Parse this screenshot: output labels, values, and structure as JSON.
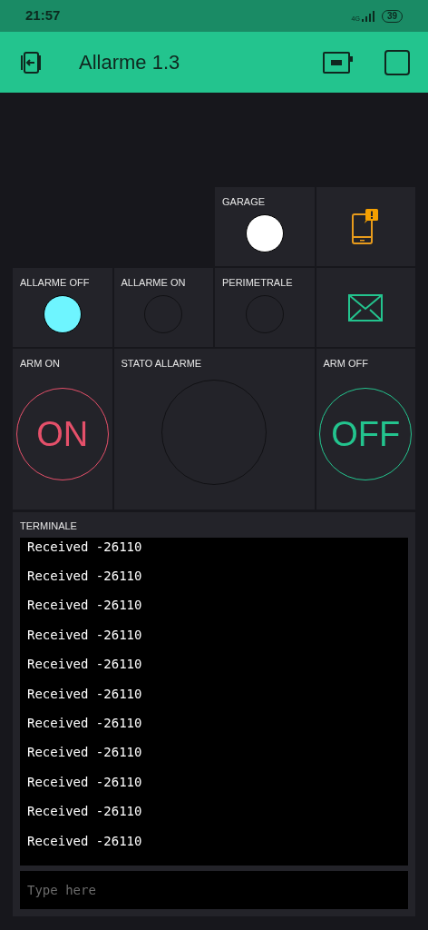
{
  "status_bar": {
    "time": "21:57",
    "network": "4G",
    "battery": "39"
  },
  "header": {
    "title": "Allarme 1.3"
  },
  "rows": [
    [
      {
        "kind": "led",
        "label": "GARAGE",
        "on": true,
        "color": "#ffffff"
      },
      {
        "kind": "notification"
      }
    ],
    [
      {
        "kind": "led",
        "label": "ALLARME OFF",
        "on": true,
        "color": "#6ef5ff"
      },
      {
        "kind": "led",
        "label": "ALLARME ON",
        "on": false
      },
      {
        "kind": "led",
        "label": "PERIMETRALE",
        "on": false
      },
      {
        "kind": "email"
      }
    ],
    [
      {
        "kind": "button",
        "label": "ARM ON",
        "text": "ON",
        "color": "#e5506a"
      },
      {
        "kind": "big_led",
        "label": "STATO ALLARME",
        "on": false
      },
      {
        "kind": "button",
        "label": "ARM OFF",
        "text": "OFF",
        "color": "#23c48e"
      }
    ]
  ],
  "terminal": {
    "label": "TERMINALE",
    "lines": [
      "Received -26110",
      "Received -26110",
      "Received -26110",
      "Received -26110",
      "Received -26110",
      "Received -26110",
      "Received -26110",
      "Received -26110",
      "Received -26110",
      "Received -26110",
      "Received -26110"
    ],
    "input": {
      "placeholder": "Type here"
    }
  }
}
